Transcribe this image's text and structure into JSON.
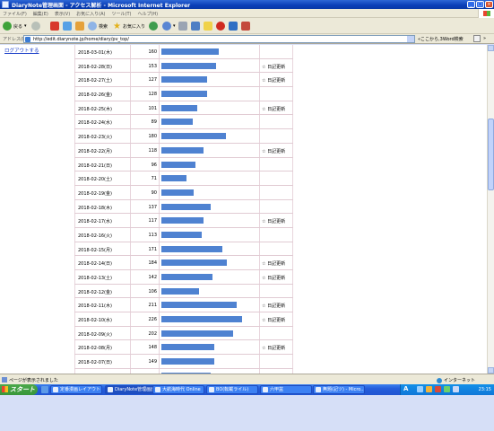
{
  "window": {
    "title": "DiaryNote管理画面 - アクセス解析 - Microsoft Internet Explorer"
  },
  "menu": [
    "ファイル(F)",
    "編集(E)",
    "表示(V)",
    "お気に入り(A)",
    "ツール(T)",
    "ヘルプ(H)"
  ],
  "toolbar": {
    "back_label": "戻る",
    "search_label": "検索",
    "favorites_label": "お気に入り"
  },
  "address": {
    "label": "アドレス(D)",
    "url": "http://edit.diarynote.jp/home/diary/pv_top/",
    "search_text": "«ここから,3Word検索",
    "links_label": "»"
  },
  "sidebar": {
    "logout_label": "ログアウトする"
  },
  "rows": [
    {
      "date": "2018-03-01(木)",
      "pv": "160",
      "ratio": 0.64,
      "update": ""
    },
    {
      "date": "2018-02-28(日)",
      "pv": "153",
      "ratio": 0.61,
      "update": "☆ 日記更新"
    },
    {
      "date": "2018-02-27(土)",
      "pv": "127",
      "ratio": 0.51,
      "update": "☆ 日記更新"
    },
    {
      "date": "2018-02-26(金)",
      "pv": "128",
      "ratio": 0.51,
      "update": ""
    },
    {
      "date": "2018-02-25(木)",
      "pv": "101",
      "ratio": 0.4,
      "update": "☆ 日記更新"
    },
    {
      "date": "2018-02-24(水)",
      "pv": "89",
      "ratio": 0.35,
      "update": ""
    },
    {
      "date": "2018-02-23(火)",
      "pv": "180",
      "ratio": 0.72,
      "update": ""
    },
    {
      "date": "2018-02-22(月)",
      "pv": "118",
      "ratio": 0.47,
      "update": "☆ 日記更新"
    },
    {
      "date": "2018-02-21(日)",
      "pv": "96",
      "ratio": 0.38,
      "update": ""
    },
    {
      "date": "2018-02-20(土)",
      "pv": "71",
      "ratio": 0.28,
      "update": ""
    },
    {
      "date": "2018-02-19(金)",
      "pv": "90",
      "ratio": 0.36,
      "update": ""
    },
    {
      "date": "2018-02-18(木)",
      "pv": "137",
      "ratio": 0.55,
      "update": ""
    },
    {
      "date": "2018-02-17(水)",
      "pv": "117",
      "ratio": 0.47,
      "update": "☆ 日記更新"
    },
    {
      "date": "2018-02-16(火)",
      "pv": "113",
      "ratio": 0.45,
      "update": ""
    },
    {
      "date": "2018-02-15(月)",
      "pv": "171",
      "ratio": 0.68,
      "update": ""
    },
    {
      "date": "2018-02-14(日)",
      "pv": "184",
      "ratio": 0.73,
      "update": "☆ 日記更新"
    },
    {
      "date": "2018-02-13(土)",
      "pv": "142",
      "ratio": 0.57,
      "update": "☆ 日記更新"
    },
    {
      "date": "2018-02-12(金)",
      "pv": "106",
      "ratio": 0.42,
      "update": ""
    },
    {
      "date": "2018-02-11(木)",
      "pv": "211",
      "ratio": 0.84,
      "update": "☆ 日記更新"
    },
    {
      "date": "2018-02-10(水)",
      "pv": "226",
      "ratio": 0.9,
      "update": "☆ 日記更新"
    },
    {
      "date": "2018-02-09(火)",
      "pv": "202",
      "ratio": 0.8,
      "update": ""
    },
    {
      "date": "2018-02-08(月)",
      "pv": "148",
      "ratio": 0.59,
      "update": "☆ 日記更新"
    },
    {
      "date": "2018-02-07(日)",
      "pv": "149",
      "ratio": 0.59,
      "update": ""
    },
    {
      "date": "2018-02-06(土)",
      "pv": "137",
      "ratio": 0.55,
      "update": "☆ 日記更新"
    }
  ],
  "status": {
    "text": "ページが表示されました",
    "zone": "インターネット"
  },
  "taskbar": {
    "start_label": "スタート",
    "tasks": [
      {
        "label": "定番漫画レイアウト 実",
        "active": false
      },
      {
        "label": "DiaryNote管理画面",
        "active": true
      },
      {
        "label": "大航海時代 Online",
        "active": false
      },
      {
        "label": "BO(転載ライル)",
        "active": false
      },
      {
        "label": "六甲盆",
        "active": false
      },
      {
        "label": "無題(記ツ) - Micro...",
        "active": false
      }
    ],
    "ime": "A",
    "clock": "23:15"
  },
  "colors": {
    "bar": "#4f82d1",
    "row_border": "#e1cbd3",
    "link": "#1b3fc9",
    "taskbar": "#245ddb",
    "start": "#37963a"
  }
}
